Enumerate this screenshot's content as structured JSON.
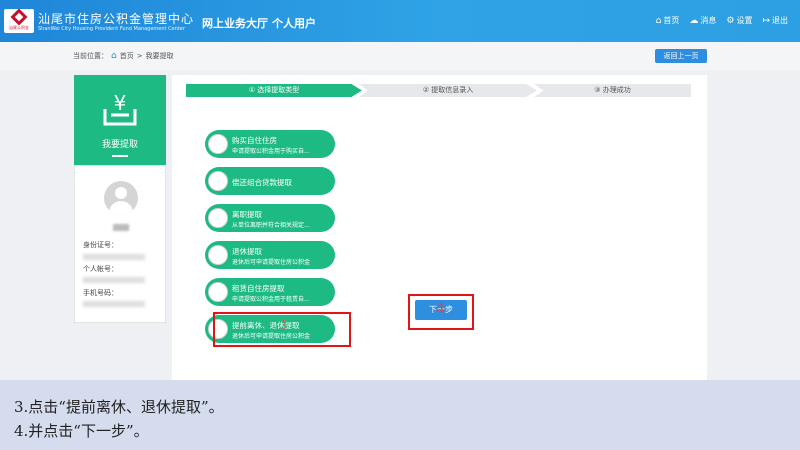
{
  "header": {
    "org_cn": "汕尾市住房公积金管理中心",
    "org_en": "ShanWei City Housing Provident Fund Management Center",
    "logo_text": "汕尾公积金",
    "nav_hall": "网上业务大厅",
    "nav_user": "个人用户",
    "links": [
      {
        "icon": "home-icon",
        "label": "首页"
      },
      {
        "icon": "message-icon",
        "label": "消息"
      },
      {
        "icon": "settings-icon",
        "label": "设置"
      },
      {
        "icon": "logout-icon",
        "label": "退出"
      }
    ]
  },
  "breadcrumb": {
    "prefix": "当前位置：",
    "home": "首页",
    "separator": ">",
    "current": "我要提取"
  },
  "back_button": "返回上一页",
  "sidebar": {
    "title": "我要提取",
    "icon": "wallet-yen-icon",
    "id_label": "身份证号：",
    "account_label": "个人帐号：",
    "phone_label": "手机号码："
  },
  "steps": [
    "① 选择提取类型",
    "② 提取信息录入",
    "③ 办理成功"
  ],
  "options": [
    {
      "title": "购买自住住房",
      "sub": "申请提取公积金用于购买自..."
    },
    {
      "title": "偿还组合贷款提取",
      "sub": ""
    },
    {
      "title": "离职提取",
      "sub": "从单位离职并符合相关规定..."
    },
    {
      "title": "退休提取",
      "sub": "退休后可申请提取住房公积金"
    },
    {
      "title": "租赁自住房提取",
      "sub": "申请提取公积金用于租赁自..."
    },
    {
      "title": "提前离休、退休提取",
      "sub": "退休后可申请提取住房公积金"
    }
  ],
  "next_button": "下一步",
  "annotations": {
    "step3": "3",
    "step4": "4"
  },
  "colors": {
    "primary_green": "#1dba84",
    "header_blue": "#2fa3e6",
    "button_blue": "#2e8fe0",
    "highlight_red": "#e01515"
  },
  "instructions": [
    "3.点击“提前离休、退休提取”。",
    "4.并点击“下一步”。"
  ]
}
